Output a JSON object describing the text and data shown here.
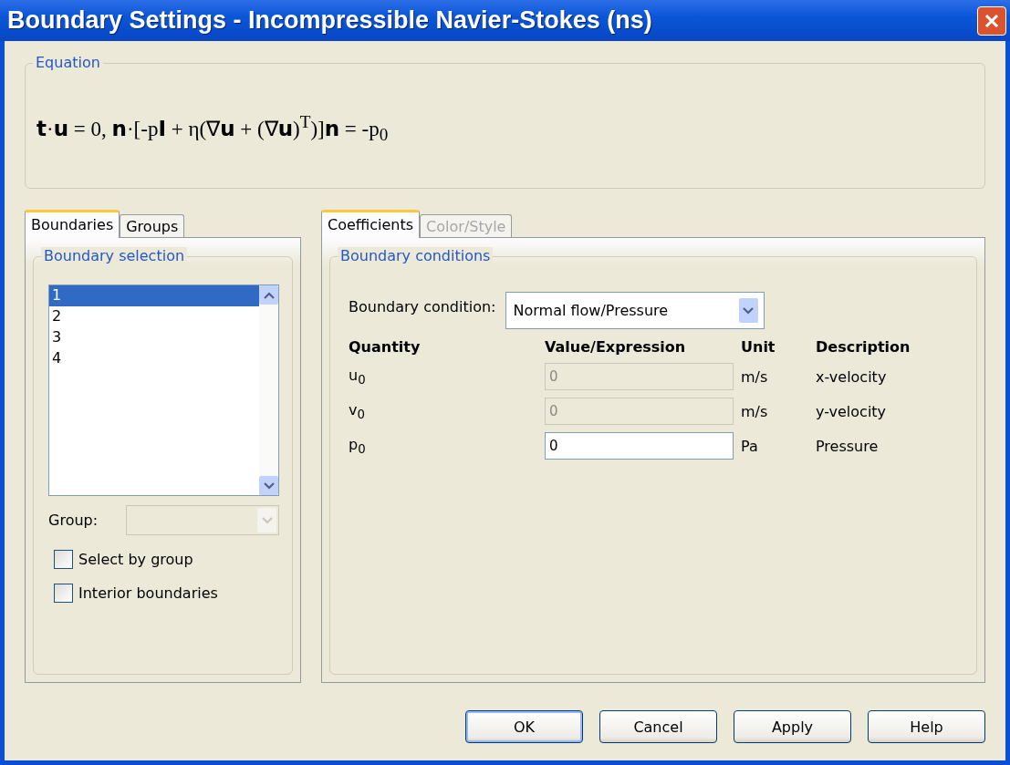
{
  "window": {
    "title": "Boundary Settings - Incompressible Navier-Stokes (ns)"
  },
  "equation": {
    "label": "Equation",
    "text": "**t**·**u** = 0, **n**·[-p**I** + η(∇**u** + (∇**u**)$^{T}$)]**n** = -p$_{0}$"
  },
  "left_tabs": [
    {
      "label": "Boundaries",
      "selected": true
    },
    {
      "label": "Groups",
      "selected": false
    }
  ],
  "boundary_selection": {
    "label": "Boundary selection",
    "items": [
      {
        "label": "1",
        "selected": true
      },
      {
        "label": "2",
        "selected": false
      },
      {
        "label": "3",
        "selected": false
      },
      {
        "label": "4",
        "selected": false
      }
    ],
    "group": {
      "label": "Group:",
      "disabled": true
    }
  },
  "checkboxes": [
    {
      "label": "Select by group",
      "checked": false
    },
    {
      "label": "Interior boundaries",
      "checked": false
    }
  ],
  "right_tabs": [
    {
      "label": "Coefficients",
      "selected": true,
      "disabled": false
    },
    {
      "label": "Color/Style",
      "selected": false,
      "disabled": true
    }
  ],
  "boundary_conditions": {
    "label": "Boundary conditions",
    "condition": {
      "label": "Boundary condition:",
      "value": "Normal flow/Pressure"
    },
    "columns": [
      "Quantity",
      "Value/Expression",
      "Unit",
      "Description"
    ],
    "rows": [
      {
        "quantity": "u$_{0}$",
        "value": "0",
        "disabled": true,
        "unit": "m/s",
        "description": "x-velocity"
      },
      {
        "quantity": "v$_{0}$",
        "value": "0",
        "disabled": true,
        "unit": "m/s",
        "description": "y-velocity"
      },
      {
        "quantity": "p$_{0}$",
        "value": "0",
        "disabled": false,
        "unit": "Pa",
        "description": "Pressure"
      }
    ]
  },
  "buttons": [
    {
      "label": "OK",
      "default": true
    },
    {
      "label": "Cancel",
      "default": false
    },
    {
      "label": "Apply",
      "default": false
    },
    {
      "label": "Help",
      "default": false
    }
  ]
}
